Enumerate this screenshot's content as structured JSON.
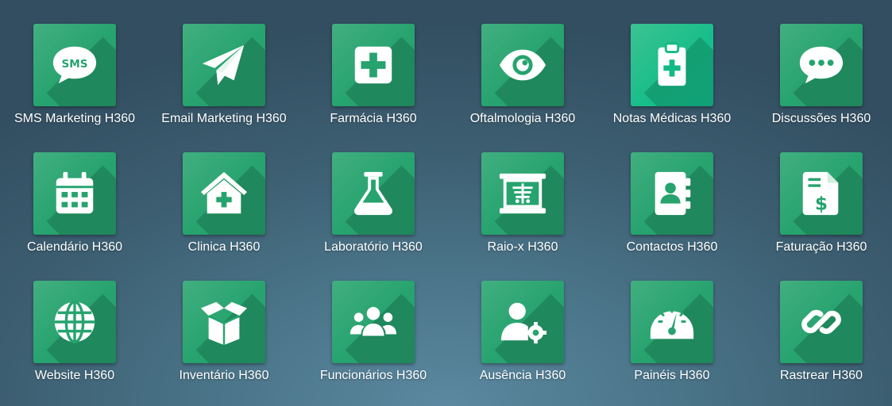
{
  "apps": [
    {
      "label": "SMS Marketing H360",
      "icon": "sms-bubble-icon",
      "sms_text": "SMS"
    },
    {
      "label": "Email Marketing H360",
      "icon": "paper-plane-icon"
    },
    {
      "label": "Farmácia H360",
      "icon": "medical-cross-icon"
    },
    {
      "label": "Oftalmologia H360",
      "icon": "eye-icon"
    },
    {
      "label": "Notas Médicas H360",
      "icon": "clipboard-medical-icon"
    },
    {
      "label": "Discussões H360",
      "icon": "chat-bubble-icon"
    },
    {
      "label": "Calendário H360",
      "icon": "calendar-icon"
    },
    {
      "label": "Clinica H360",
      "icon": "clinic-house-icon"
    },
    {
      "label": "Laboratório H360",
      "icon": "lab-flask-icon"
    },
    {
      "label": "Raio-x H360",
      "icon": "xray-screen-icon"
    },
    {
      "label": "Contactos H360",
      "icon": "address-book-icon"
    },
    {
      "label": "Faturação H360",
      "icon": "invoice-dollar-icon"
    },
    {
      "label": "Website H360",
      "icon": "globe-icon"
    },
    {
      "label": "Inventário H360",
      "icon": "open-box-icon"
    },
    {
      "label": "Funcionários H360",
      "icon": "user-group-icon"
    },
    {
      "label": "Ausência H360",
      "icon": "user-gear-icon"
    },
    {
      "label": "Painéis H360",
      "icon": "dashboard-gauge-icon"
    },
    {
      "label": "Rastrear H360",
      "icon": "link-icon"
    }
  ],
  "colors": {
    "tile": "#26a36e",
    "tile_highlight": "#12c28e",
    "glyph": "#ffffff",
    "label": "#ffffff"
  }
}
